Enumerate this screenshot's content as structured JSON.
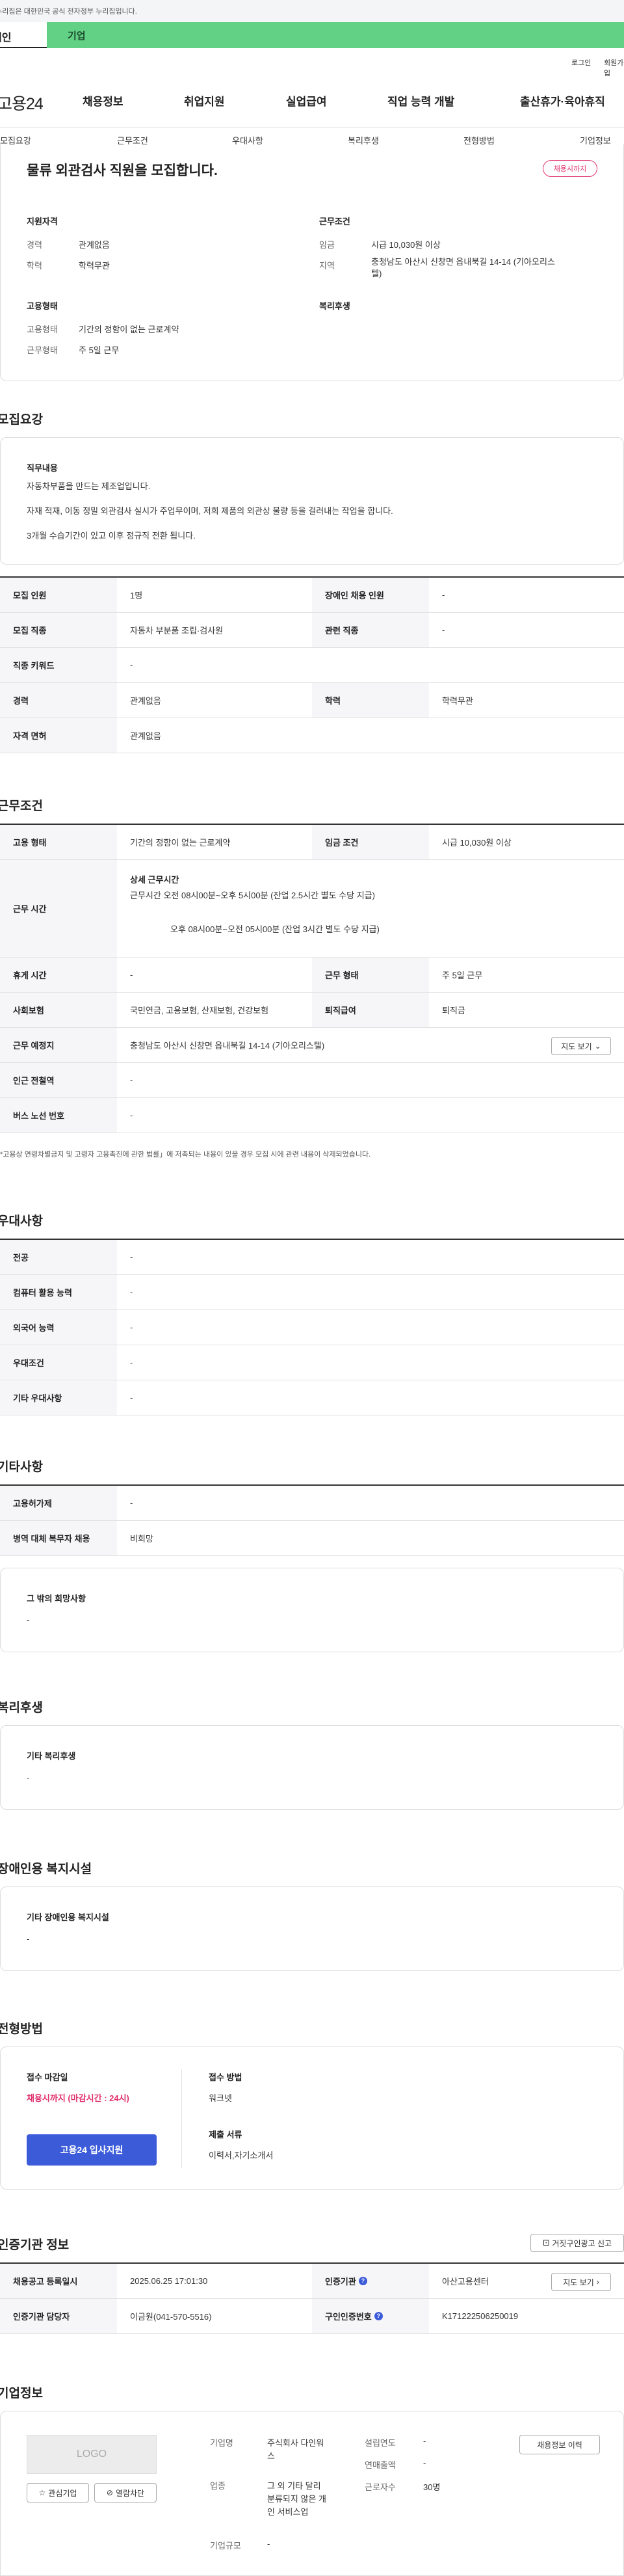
{
  "gov_banner": "이 누리집은 대한민국 공식 전자정부 누리집입니다.",
  "user_tabs": {
    "individual": "개인",
    "company": "기업"
  },
  "util": {
    "login": "로그인",
    "join": "회원가입"
  },
  "logo": "고용24",
  "gnb": [
    "채용정보",
    "취업지원",
    "실업급여",
    "직업 능력 개발",
    "출산휴가·육아휴직"
  ],
  "snb": [
    "모집요강",
    "근무조건",
    "우대사항",
    "복리후생",
    "전형방법",
    "기업정보"
  ],
  "job": {
    "title": "물류 외관검사 직원을 모집합니다.",
    "status": "채용시까지"
  },
  "summary": {
    "qual_h": "지원자격",
    "cond_h": "근무조건",
    "career_l": "경력",
    "career_v": "관계없음",
    "edu_l": "학력",
    "edu_v": "학력무관",
    "pay_l": "임금",
    "pay_v": "시급 10,030원 이상",
    "area_l": "지역",
    "area_v1": "충청남도 아산시 신창면 읍내북길 14-14 (기아오리스",
    "area_v2": "텔)",
    "emp_h": "고용형태",
    "welfare_h": "복리후생",
    "emptype_l": "고용형태",
    "emptype_v": "기간의 정함이 없는 근로계약",
    "worktype_l": "근무형태",
    "worktype_v": "주 5일 근무"
  },
  "recruit": {
    "heading": "모집요강",
    "duty_h": "직무내용",
    "duty_1": "자동차부품을 만드는 제조업입니다.",
    "duty_2": "자재 적재, 이동 정밀 외관검사 실시가 주업무이며, 저희 제품의 외관상 불량 등을 걸러내는 작업을 합니다.",
    "duty_3": "3개월 수습기간이 있고 이후 정규직 전환 됩니다.",
    "rows": [
      [
        "모집 인원",
        "1명",
        "장애인 채용 인원",
        "-"
      ],
      [
        "모집 직종",
        "자동차 부분품 조립·검사원",
        "관련 직종",
        "-"
      ],
      [
        "직종 키워드",
        "-"
      ],
      [
        "경력",
        "관계없음",
        "학력",
        "학력무관"
      ],
      [
        "자격 면허",
        "관계없음"
      ]
    ]
  },
  "work": {
    "heading": "근무조건",
    "emptype_l": "고용 형태",
    "emptype_v": "기간의 정함이 없는 근로계약",
    "wage_l": "임금 조건",
    "wage_v": "시급 10,030원 이상",
    "hours_l": "근무 시간",
    "hours_h": "상세 근무시간",
    "hours_1": "근무시간 오전 08시00분~오후 5시00분 (잔업 2.5시간 별도 수당 지급)",
    "hours_2": "오후 08시00분~오전 05시00분 (잔업 3시간 별도 수당 지급)",
    "rest_l": "휴게 시간",
    "rest_v": "-",
    "worktype_l": "근무 형태",
    "worktype_v": "주 5일 근무",
    "ins_l": "사회보험",
    "ins_v": "국민연금, 고용보험, 산재보험, 건강보험",
    "retire_l": "퇴직급여",
    "retire_v": "퇴직금",
    "place_l": "근무 예정지",
    "place_v": "충청남도 아산시 신창면 읍내북길 14-14 (기아오리스텔)",
    "map_btn": "지도 보기",
    "subway_l": "인근 전철역",
    "subway_v": "-",
    "bus_l": "버스 노선 번호",
    "bus_v": "-",
    "note": "*고용상 연령차별금지 및 고령자 고용촉진에 관한 법률」에 저촉되는 내용이 있을 경우 모집 시에 관련 내용이 삭제되었습니다."
  },
  "pref": {
    "heading": "우대사항",
    "rows": [
      [
        "전공",
        "-"
      ],
      [
        "컴퓨터 활용 능력",
        "-"
      ],
      [
        "외국어 능력",
        "-"
      ],
      [
        "우대조건",
        "-"
      ],
      [
        "기타 우대사항",
        "-"
      ]
    ]
  },
  "etc": {
    "heading": "기타사항",
    "rows": [
      [
        "고용허가제",
        "-"
      ],
      [
        "병역 대체 복무자 채용",
        "비희망"
      ]
    ],
    "other_h": "그 밖의 희망사항",
    "other_v": "-"
  },
  "welfare": {
    "heading": "복리후생",
    "box_h": "기타 복리후생",
    "box_v": "-"
  },
  "disab": {
    "heading": "장애인용 복지시설",
    "box_h": "기타 장애인용 복지시설",
    "box_v": "-"
  },
  "screening": {
    "heading": "전형방법",
    "deadline_h": "접수 마감일",
    "deadline_v": "채용시까지 (마감시간 : 24시)",
    "apply_btn": "고용24 입사지원",
    "method_h": "접수 방법",
    "method_v": "워크넷",
    "docs_h": "제출 서류",
    "docs_v": "이력서,자기소개서"
  },
  "cert": {
    "heading": "인증기관 정보",
    "report_btn": "거짓구인광고 신고",
    "reg_l": "채용공고 등록일시",
    "reg_v": "2025.06.25 17:01:30",
    "org_l": "인증기관",
    "org_v": "아산고용센터",
    "history_btn": "지도 보기",
    "mgr_l": "인증기관 담당자",
    "mgr_v": "이금원(041-570-5516)",
    "num_l": "구인인증번호",
    "num_v": "K171222506250019"
  },
  "company": {
    "heading": "기업정보",
    "logo": "LOGO",
    "interest_btn": "관심기업",
    "block_btn": "열람차단",
    "name_l": "기업명",
    "name_v1": "주식회사 다인워",
    "name_v2": "스",
    "ind_l": "업종",
    "ind_v1": "그 외 기타 달리",
    "ind_v2": "분류되지 않은 개",
    "ind_v3": "인 서비스업",
    "size_l": "기업규모",
    "size_v": "-",
    "year_l": "설립연도",
    "year_v": "-",
    "sales_l": "연매출액",
    "sales_v": "-",
    "emp_l": "근로자수",
    "emp_v": "30명",
    "history_btn": "채용정보 이력"
  }
}
